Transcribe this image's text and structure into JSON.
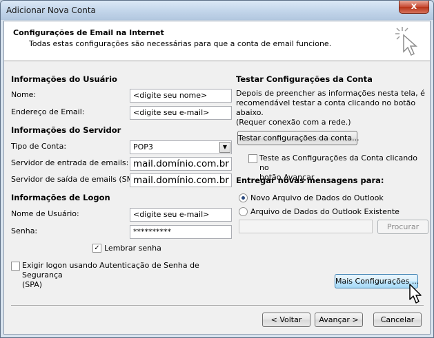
{
  "window": {
    "title": "Adicionar Nova Conta",
    "close_glyph": "x"
  },
  "header": {
    "title": "Configurações de Email na Internet",
    "subtitle": "Todas estas configurações são necessárias para que a conta de email funcione."
  },
  "user_info": {
    "section_title": "Informações do Usuário",
    "name_label": "Nome:",
    "name_value": "<digite seu nome>",
    "email_label": "Endereço de Email:",
    "email_value": "<digite seu e-mail>"
  },
  "server_info": {
    "section_title": "Informações do Servidor",
    "account_type_label": "Tipo de Conta:",
    "account_type_value": "POP3",
    "incoming_label": "Servidor de entrada de emails:",
    "incoming_value": "mail.domínio.com.br",
    "outgoing_label": "Servidor de saída de emails (SMTP):",
    "outgoing_value": "mail.domínio.com.br"
  },
  "logon_info": {
    "section_title": "Informações de Logon",
    "username_label": "Nome de Usuário:",
    "username_value": "<digite seu e-mail>",
    "password_label": "Senha:",
    "password_value": "**********",
    "remember_label": "Lembrar senha",
    "remember_checked": true,
    "spa_label": "Exigir logon usando Autenticação de Senha de Segurança\n(SPA)",
    "spa_checked": false
  },
  "test_settings": {
    "section_title": "Testar Configurações da Conta",
    "description": "Depois de preencher as informações nesta tela, é\nrecomendável testar a conta clicando no botão abaixo.\n(Requer conexão com a rede.)",
    "test_button": "Testar configurações da conta...",
    "auto_test_label": "Teste as Configurações da Conta clicando no\nbotão Avançar",
    "auto_test_checked": false
  },
  "deliver": {
    "section_title": "Entregar novas mensagens para:",
    "new_file_label": "Novo Arquivo de Dados do Outlook",
    "existing_file_label": "Arquivo de Dados do Outlook Existente",
    "existing_path_value": "",
    "browse_button": "Procurar"
  },
  "more_settings_button": "Mais Configurações ...",
  "footer": {
    "back_button": "< Voltar",
    "next_button": "Avançar >",
    "cancel_button": "Cancelar"
  },
  "colors": {
    "accent": "#3c7fb1",
    "title_bar": "#c2d5ea",
    "close_button": "#c74a33"
  }
}
